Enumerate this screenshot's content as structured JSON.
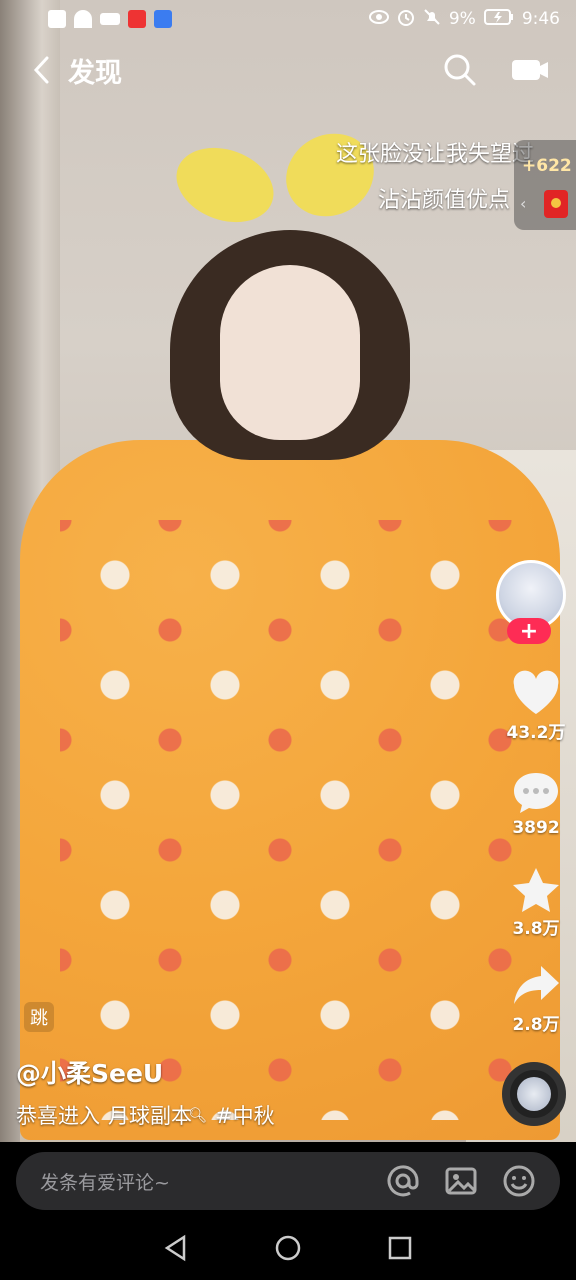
{
  "status_bar": {
    "battery": "9%",
    "time": "9:46"
  },
  "header": {
    "title": "发现"
  },
  "overlay": {
    "caption_line1": "这张脸没让我失望过",
    "caption_line2": "沾沾颜值优点",
    "reward_count": "+622"
  },
  "rail": {
    "like_count": "43.2万",
    "comment_count": "3892",
    "favorite_count": "3.8万",
    "share_count": "2.8万"
  },
  "post": {
    "badge": "跳",
    "author": "@小柔SeeU",
    "desc_text1": "恭喜进入",
    "desc_text2": "月球副本",
    "hashtag": "#中秋"
  },
  "comment_bar": {
    "placeholder": "发条有爱评论~"
  },
  "colors": {
    "accent_pink": "#fe2c55",
    "comment_bar_bg": "#2b2b2d",
    "reward_text": "#ffe6a6"
  }
}
